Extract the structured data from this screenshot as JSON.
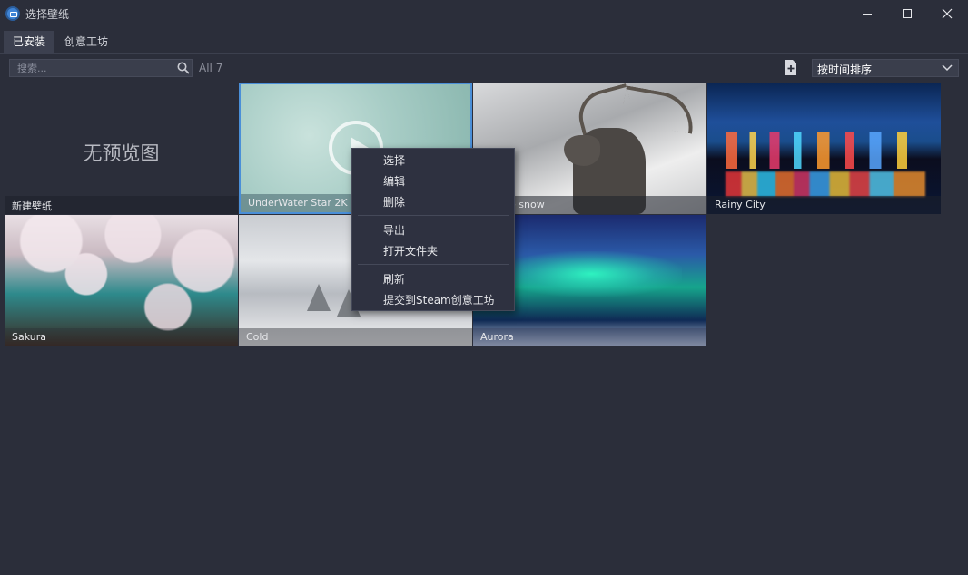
{
  "window": {
    "title": "选择壁纸",
    "controls": {
      "minimize": "minimize",
      "maximize": "maximize",
      "close": "close"
    }
  },
  "tabs": [
    {
      "label": "已安装",
      "active": true
    },
    {
      "label": "创意工坊",
      "active": false
    }
  ],
  "toolbar": {
    "search_placeholder": "搜索...",
    "count": "All 7",
    "sort_value": "按时间排序"
  },
  "wallpapers": [
    {
      "name": "新建壁纸",
      "placeholder_text": "无预览图"
    },
    {
      "name": "UnderWater Star 2K HD",
      "selected": true
    },
    {
      "name": "e snow"
    },
    {
      "name": "Rainy City"
    },
    {
      "name": "Sakura"
    },
    {
      "name": "Cold"
    },
    {
      "name": "Aurora"
    }
  ],
  "context_menu": {
    "items": [
      "选择",
      "编辑",
      "删除",
      "导出",
      "打开文件夹",
      "刷新",
      "提交到Steam创意工坊"
    ]
  },
  "colors": {
    "background": "#2b2e3a",
    "selection": "#4a8fd8",
    "menu_background": "#2e3140"
  },
  "icons": [
    "app-icon",
    "search-icon",
    "new-file-icon",
    "chevron-down-icon",
    "play-icon",
    "minimize-icon",
    "maximize-icon",
    "close-icon"
  ]
}
